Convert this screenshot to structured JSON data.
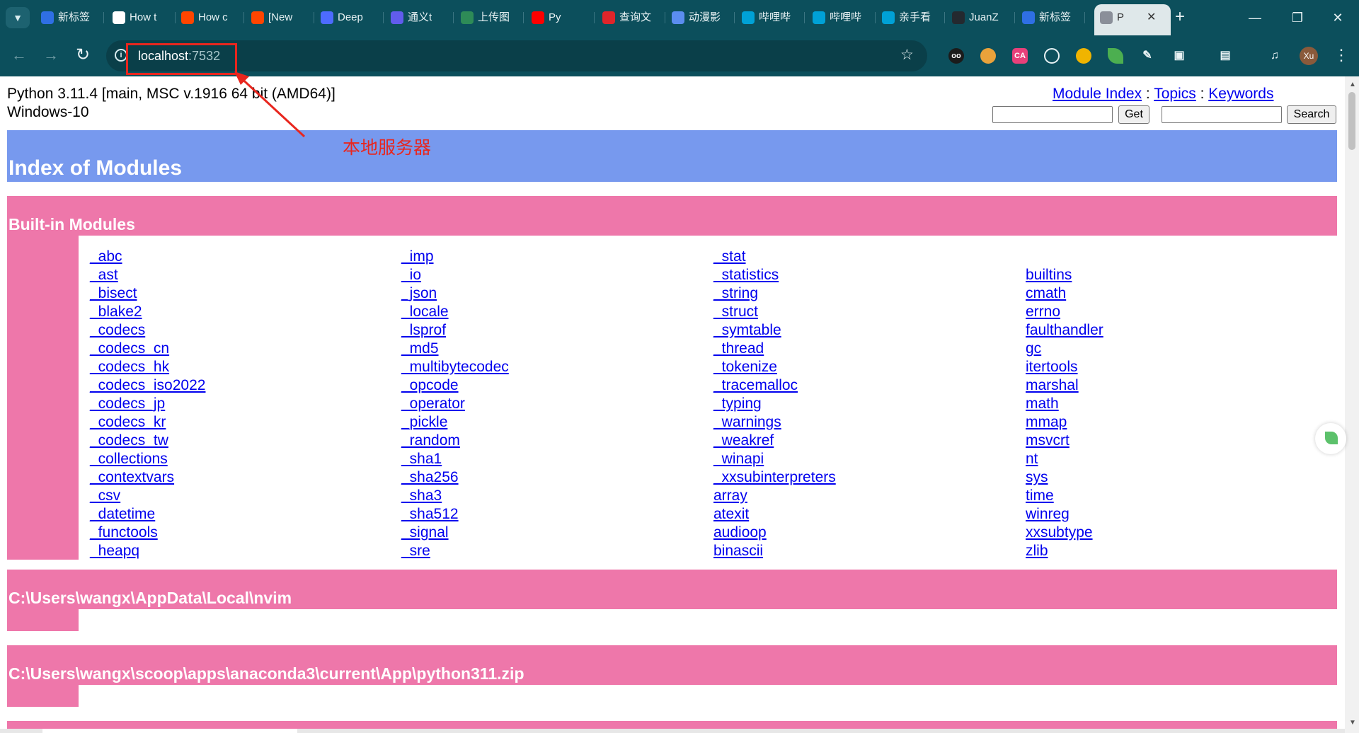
{
  "browser": {
    "tabs": [
      {
        "label": "新标签",
        "icon": "document-icon",
        "color": "#2f6fe4"
      },
      {
        "label": "How t",
        "icon": "google-icon",
        "color": "#ffffff"
      },
      {
        "label": "How c",
        "icon": "reddit-icon",
        "color": "#ff4500"
      },
      {
        "label": "[New",
        "icon": "reddit-icon",
        "color": "#ff4500"
      },
      {
        "label": "Deep",
        "icon": "deepseek-icon",
        "color": "#4d6bfe"
      },
      {
        "label": "通义t",
        "icon": "tongyi-icon",
        "color": "#615ced"
      },
      {
        "label": "上传图",
        "icon": "upload-icon",
        "color": "#2e8b57"
      },
      {
        "label": "Py",
        "icon": "youtube-icon",
        "color": "#ff0000"
      },
      {
        "label": "查询文",
        "icon": "y-logo-icon",
        "color": "#e0252a"
      },
      {
        "label": "动漫影",
        "icon": "rocket-icon",
        "color": "#5b8def"
      },
      {
        "label": "哔哩哔",
        "icon": "bilibili-icon",
        "color": "#00a1d6"
      },
      {
        "label": "哔哩哔",
        "icon": "bilibili-icon",
        "color": "#00a1d6"
      },
      {
        "label": "亲手看",
        "icon": "bilibili-icon",
        "color": "#00a1d6"
      },
      {
        "label": "JuanZ",
        "icon": "github-icon",
        "color": "#24292f"
      },
      {
        "label": "新标签",
        "icon": "document-icon",
        "color": "#2f6fe4"
      },
      {
        "label": "P",
        "icon": "globe-icon",
        "color": "#8a8f99",
        "active": true
      }
    ],
    "url_host": "localhost",
    "url_port": ":7532"
  },
  "annotation": {
    "text": "本地服务器",
    "color": "#e8261e"
  },
  "page": {
    "sys_line1": "Python 3.11.4 [main, MSC v.1916 64 bit (AMD64)]",
    "sys_line2": "Windows-10",
    "links": {
      "module_index": "Module Index",
      "topics": "Topics",
      "keywords": "Keywords",
      "sep": " : "
    },
    "get_button": "Get",
    "search_button": "Search",
    "title": "Index of Modules",
    "title_bg": "#7799ee",
    "section_bg": "#ee77aa",
    "builtin_heading": "Built-in Modules",
    "builtin_columns": [
      [
        "_abc",
        "_ast",
        "_bisect",
        "_blake2",
        "_codecs",
        "_codecs_cn",
        "_codecs_hk",
        "_codecs_iso2022",
        "_codecs_jp",
        "_codecs_kr",
        "_codecs_tw",
        "_collections",
        "_contextvars",
        "_csv",
        "_datetime",
        "_functools",
        "_heapq"
      ],
      [
        "_imp",
        "_io",
        "_json",
        "_locale",
        "_lsprof",
        "_md5",
        "_multibytecodec",
        "_opcode",
        "_operator",
        "_pickle",
        "_random",
        "_sha1",
        "_sha256",
        "_sha3",
        "_sha512",
        "_signal",
        "_sre"
      ],
      [
        "_stat",
        "_statistics",
        "_string",
        "_struct",
        "_symtable",
        "_thread",
        "_tokenize",
        "_tracemalloc",
        "_typing",
        "_warnings",
        "_weakref",
        "_winapi",
        "_xxsubinterpreters",
        "array",
        "atexit",
        "audioop",
        "binascii"
      ],
      [
        "builtins",
        "cmath",
        "errno",
        "faulthandler",
        "gc",
        "itertools",
        "marshal",
        "math",
        "mmap",
        "msvcrt",
        "nt",
        "sys",
        "time",
        "winreg",
        "xxsubtype",
        "zlib"
      ]
    ],
    "path_sections": [
      "C:\\Users\\wangx\\AppData\\Local\\nvim",
      "C:\\Users\\wangx\\scoop\\apps\\anaconda3\\current\\App\\python311.zip"
    ]
  }
}
